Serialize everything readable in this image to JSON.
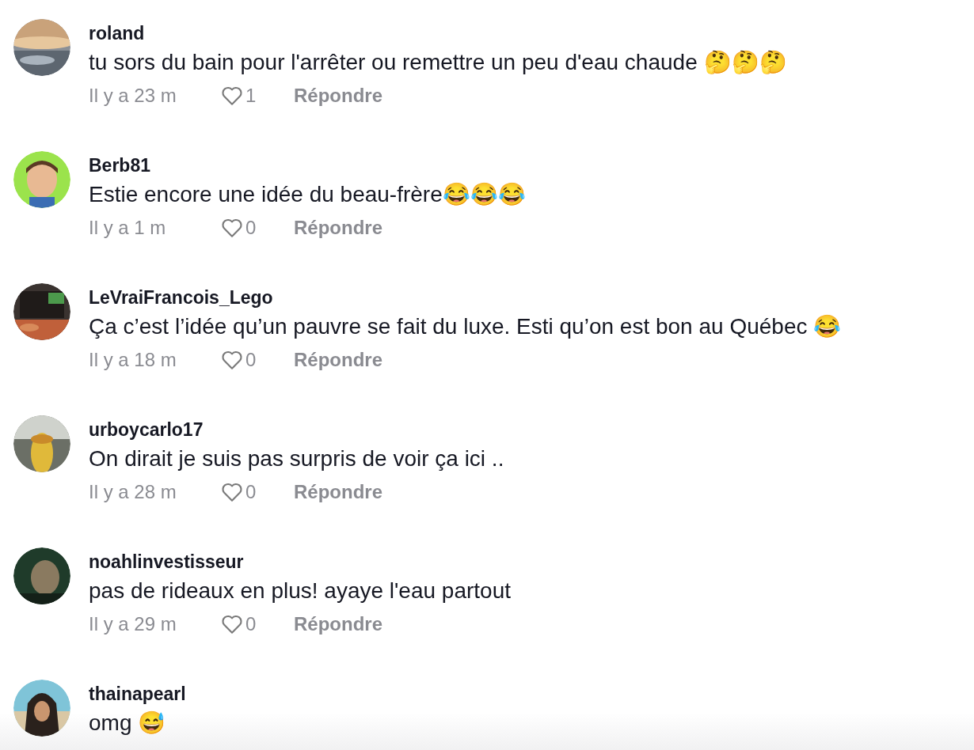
{
  "comments": [
    {
      "user": "roland",
      "text": "tu sors du bain pour l'arrêter ou remettre un peu d'eau chaude 🤔🤔🤔",
      "time": "Il y a 23 m",
      "likes": "1",
      "reply": "Répondre"
    },
    {
      "user": "Berb81",
      "text": "Estie encore une idée du beau-frère😂😂😂",
      "time": "Il y a 1 m",
      "likes": "0",
      "reply": "Répondre"
    },
    {
      "user": "LeVraiFrancois_Lego",
      "text": "Ça c’est l’idée qu’un pauvre se fait du luxe. Esti qu’on est bon au Québec 😂",
      "time": "Il y a 18 m",
      "likes": "0",
      "reply": "Répondre"
    },
    {
      "user": "urboycarlo17",
      "text": "On dirait je suis pas surpris de voir ça ici ..",
      "time": "Il y a 28 m",
      "likes": "0",
      "reply": "Répondre"
    },
    {
      "user": "noahlinvestisseur",
      "text": "pas de rideaux en plus! ayaye l'eau partout",
      "time": "Il y a 29 m",
      "likes": "0",
      "reply": "Répondre"
    },
    {
      "user": "thainapearl",
      "text": "omg 😅"
    }
  ]
}
